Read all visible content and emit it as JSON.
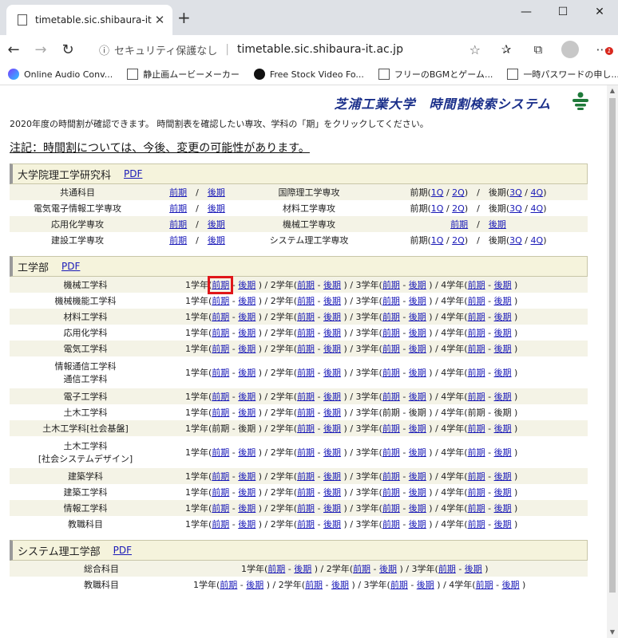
{
  "browser": {
    "tab_title": "timetable.sic.shibaura-it.ac.jp",
    "security_label": "セキュリティ保護なし",
    "url": "timetable.sic.shibaura-it.ac.jp",
    "bookmarks": [
      {
        "label": "Online Audio Conv...",
        "icon": "audio"
      },
      {
        "label": "静止画ムービーメーカー",
        "icon": "doc"
      },
      {
        "label": "Free Stock Video Fo...",
        "icon": "pix"
      },
      {
        "label": "フリーのBGMとゲーム...",
        "icon": "doc"
      },
      {
        "label": "一時パスワードの申し...",
        "icon": "doc"
      }
    ],
    "badge": "1"
  },
  "page": {
    "system_title": "芝浦工業大学　時間割検索システム",
    "intro": "2020年度の時間割が確認できます。 時間割表を確認したい専攻、学科の「期」をクリックしてください。",
    "notice": "注記：時間割については、今後、変更の可能性があります。"
  },
  "labels": {
    "zenki": "前期",
    "kouki": "後期",
    "slash": "/",
    "dash": "-",
    "pdf": "PDF",
    "years": [
      "1学年(",
      "2学年(",
      "3学年(",
      "4学年("
    ],
    "close_paren": ")",
    "front": "前期(",
    "back": "後期("
  },
  "graduate": {
    "title": "大学院理工学研究科",
    "rows": [
      {
        "left": "共通科目",
        "right": "国際理工学専攻",
        "right_q": [
          "1Q",
          "2Q",
          "3Q",
          "4Q"
        ]
      },
      {
        "left": "電気電子情報工学専攻",
        "right": "材料工学専攻",
        "right_q": [
          "1Q",
          "2Q",
          "3Q",
          "4Q"
        ]
      },
      {
        "left": "応用化学専攻",
        "right": "機械工学専攻",
        "right_q": null
      },
      {
        "left": "建設工学専攻",
        "right": "システム理工学専攻",
        "right_q": [
          "1Q",
          "2Q",
          "3Q",
          "4Q"
        ]
      }
    ]
  },
  "engineering": {
    "title": "工学部",
    "depts": [
      {
        "name": "機械工学科"
      },
      {
        "name": "機械機能工学科"
      },
      {
        "name": "材料工学科"
      },
      {
        "name": "応用化学科"
      },
      {
        "name": "電気工学科"
      },
      {
        "name": "情報通信工学科",
        "name2": "通信工学科"
      },
      {
        "name": "電子工学科"
      },
      {
        "name": "土木工学科"
      },
      {
        "name": "土木工学科[社会基盤]"
      },
      {
        "name": "土木工学科",
        "name2": "[社会システムデザイン]"
      },
      {
        "name": "建築学科"
      },
      {
        "name": "建築工学科"
      },
      {
        "name": "情報工学科"
      },
      {
        "name": "教職科目"
      }
    ]
  },
  "system": {
    "title": "システム理工学部",
    "rows": [
      {
        "name": "総合科目"
      },
      {
        "name": "教職科目"
      }
    ]
  }
}
